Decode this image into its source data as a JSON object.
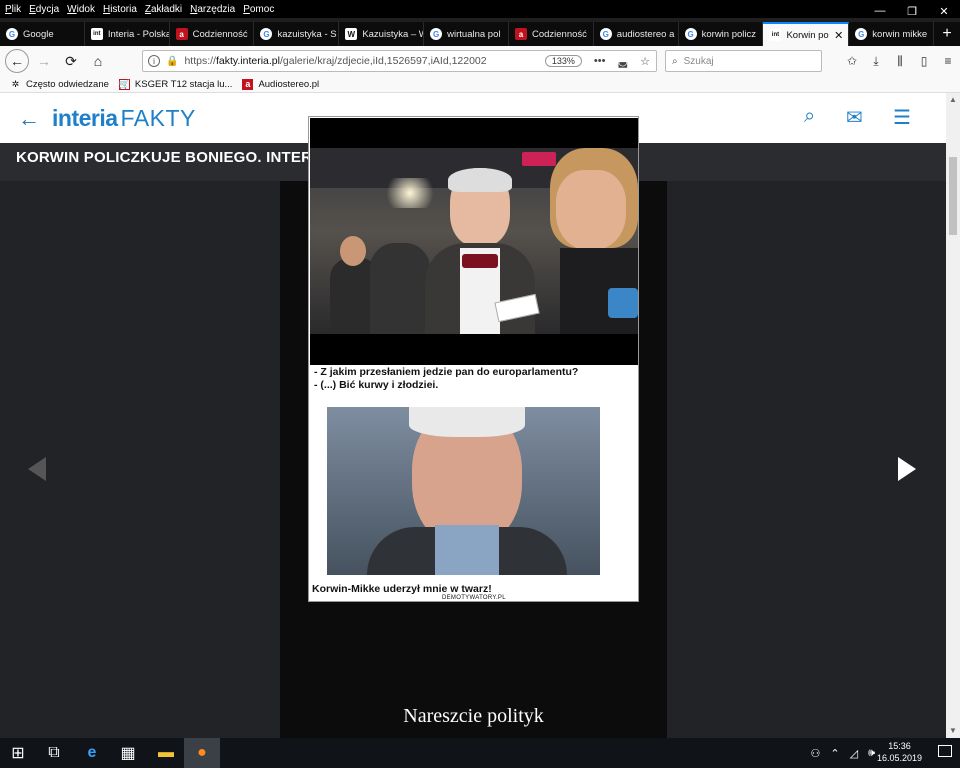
{
  "menubar": [
    "Plik",
    "Edycja",
    "Widok",
    "Historia",
    "Zakładki",
    "Narzędzia",
    "Pomoc"
  ],
  "window_controls": [
    "—",
    "❐",
    "✕"
  ],
  "tabs": [
    {
      "label": "Google",
      "fav": "G",
      "favclass": "fav-g"
    },
    {
      "label": "Interia - Polska",
      "fav": "int",
      "favclass": "fav-int"
    },
    {
      "label": "Codzienność",
      "fav": "a",
      "favclass": "fav-a"
    },
    {
      "label": "kazuistyka - S",
      "fav": "G",
      "favclass": "fav-g"
    },
    {
      "label": "Kazuistyka – W",
      "fav": "W",
      "favclass": "fav-w"
    },
    {
      "label": "wirtualna pol",
      "fav": "G",
      "favclass": "fav-g"
    },
    {
      "label": "Codzienność",
      "fav": "a",
      "favclass": "fav-a"
    },
    {
      "label": "audiostereo a",
      "fav": "G",
      "favclass": "fav-g"
    },
    {
      "label": "korwin policz",
      "fav": "G",
      "favclass": "fav-g"
    },
    {
      "label": "Korwin po",
      "fav": "int",
      "favclass": "fav-int",
      "active": true
    },
    {
      "label": "korwin mikke",
      "fav": "G",
      "favclass": "fav-g"
    }
  ],
  "navbar": {
    "url_prefix": "https://",
    "url_host": "fakty.interia.pl",
    "url_path": "/galerie/kraj/zdjecie,iId,1526597,iAId,122002",
    "zoom": "133%",
    "search_placeholder": "Szukaj"
  },
  "bookmarks": [
    {
      "label": "Często odwiedzane",
      "icon": "gear-icon"
    },
    {
      "label": "KSGER T12 stacja lu...",
      "icon": "shop-icon"
    },
    {
      "label": "Audiostereo.pl",
      "icon": "a-icon"
    }
  ],
  "site": {
    "logo_main": "interia",
    "logo_sub": "FAKTY",
    "gallery_title": "KORWIN POLICZKUJE BONIEGO. INTERNAUCI ZACHWYCENI"
  },
  "meme": {
    "caption1_line1": "- Z jakim przesłaniem jedzie pan do europarlamentu?",
    "caption1_line2": "- (...) Bić kurwy i złodziei.",
    "caption2": "Korwin-Mikke uderzył mnie w twarz!",
    "watermark": "DEMOTYWATORY.PL",
    "motto": "Nareszcie polityk"
  },
  "taskbar": {
    "time": "15:36",
    "date": "16.05.2019"
  },
  "colors": {
    "interia_blue": "#1f80c9",
    "firefox_active_tab": "#0a84ff"
  }
}
